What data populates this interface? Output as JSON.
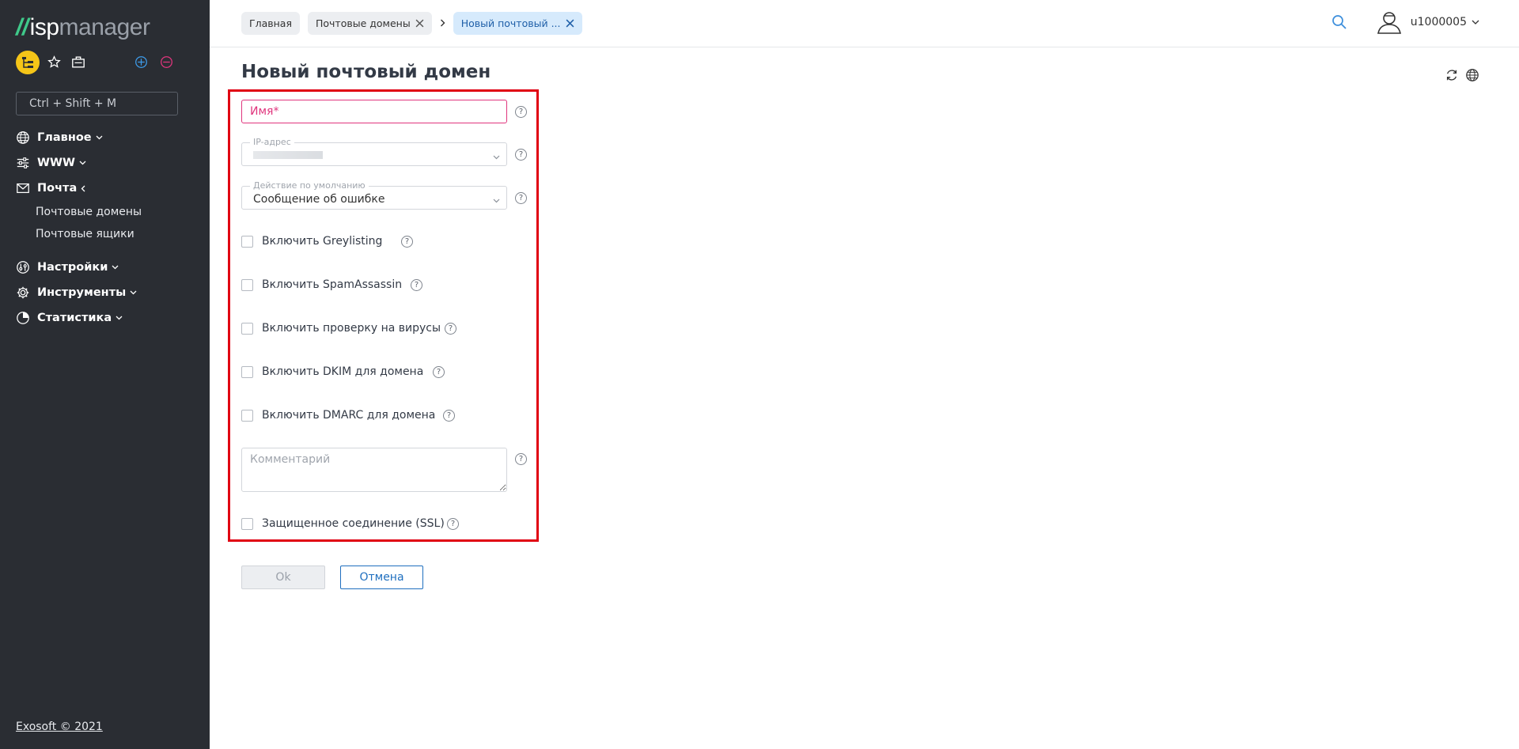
{
  "sidebar": {
    "logo": {
      "slash": "//",
      "isp": "isp",
      "manager": "manager"
    },
    "search_placeholder": "Ctrl + Shift + M",
    "nav": [
      {
        "label": "Главное",
        "icon": "globe-icon",
        "expanded": false
      },
      {
        "label": "WWW",
        "icon": "sliders-icon",
        "expanded": false
      },
      {
        "label": "Почта",
        "icon": "mail-icon",
        "expanded": true,
        "children": [
          {
            "label": "Почтовые домены"
          },
          {
            "label": "Почтовые ящики"
          }
        ]
      },
      {
        "label": "Настройки",
        "icon": "settings-icon",
        "expanded": false
      },
      {
        "label": "Инструменты",
        "icon": "gear-icon",
        "expanded": false
      },
      {
        "label": "Статистика",
        "icon": "pie-chart-icon",
        "expanded": false
      }
    ],
    "footer": "Exosoft © 2021"
  },
  "header": {
    "breadcrumbs": [
      {
        "label": "Главная",
        "closable": false,
        "active": false
      },
      {
        "label": "Почтовые домены",
        "closable": true,
        "active": false
      },
      {
        "label": "Новый почтовый ...",
        "closable": true,
        "active": true
      }
    ],
    "username": "u1000005"
  },
  "main": {
    "title": "Новый почтовый домен",
    "form": {
      "name_placeholder": "Имя*",
      "ip": {
        "legend": "IP-адрес",
        "value": ""
      },
      "default_action": {
        "legend": "Действие по умолчанию",
        "value": "Сообщение об ошибке"
      },
      "checkboxes": [
        {
          "label": "Включить Greylisting",
          "checked": false
        },
        {
          "label": "Включить SpamAssassin",
          "checked": false
        },
        {
          "label": "Включить проверку на вирусы",
          "checked": false
        },
        {
          "label": "Включить DKIM для домена",
          "checked": false
        },
        {
          "label": "Включить DMARC для домена",
          "checked": false
        }
      ],
      "comment_placeholder": "Комментарий",
      "ssl": {
        "label": "Защищенное соединение (SSL)",
        "checked": false
      },
      "help_glyph": "?"
    },
    "buttons": {
      "ok": "Ok",
      "cancel": "Отмена"
    }
  },
  "colors": {
    "sidebar_bg": "#2a2d33",
    "accent_blue": "#1f6fbf",
    "error_pink": "#e0357d",
    "highlight_red": "#e00012",
    "fav_yellow": "#f5c518",
    "logo_green": "#3fc98a"
  }
}
